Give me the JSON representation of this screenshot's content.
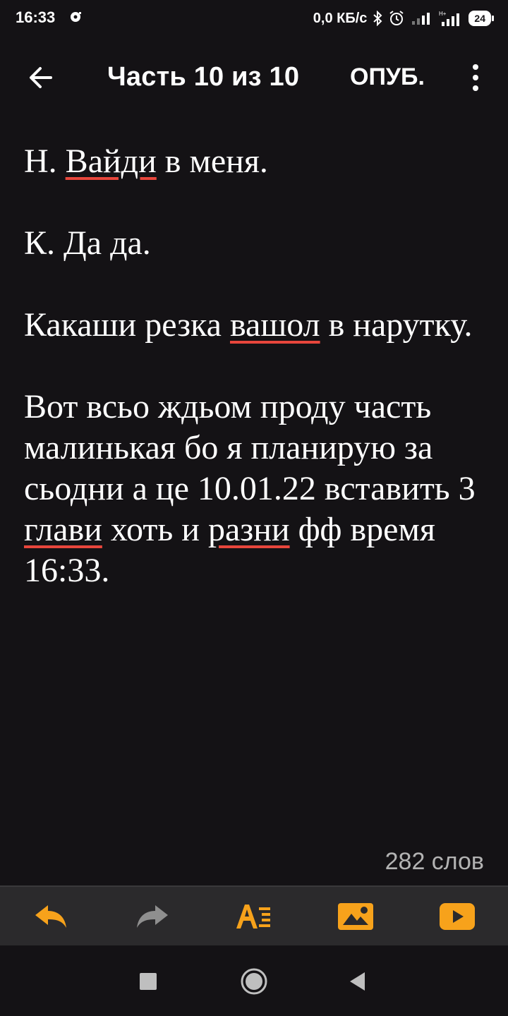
{
  "status_bar": {
    "time": "16:33",
    "net_speed": "0,0 КБ/с",
    "battery": "24"
  },
  "app_bar": {
    "title": "Часть 10 из 10",
    "publish_label": "ОПУБ."
  },
  "editor": {
    "p1": {
      "before": "Н. ",
      "misspelled": "Вайди",
      "after": " в меня."
    },
    "p2": {
      "text": "К. Да да."
    },
    "p3": {
      "before": "Какаши резка ",
      "misspelled": "вашол",
      "after": " в нарутку."
    },
    "p4": {
      "part1": "Вот всьо ждьом проду часть малинькая бо я планирую за сьодни а це 10.01.22 вставить 3 ",
      "misspelled1": "глави",
      "part2": " хоть и ",
      "misspelled2": "разни",
      "part3": " фф  время 16:33."
    }
  },
  "word_count": "282 слов",
  "colors": {
    "accent": "#f7a21b",
    "background": "#141215",
    "toolbar": "#2b2a2c",
    "spellcheck": "#e8463c"
  },
  "toolbar_icons": [
    "undo-icon",
    "redo-icon",
    "text-format-icon",
    "image-icon",
    "video-icon"
  ],
  "nav_icons": [
    "recents-icon",
    "home-icon",
    "back-nav-icon"
  ]
}
